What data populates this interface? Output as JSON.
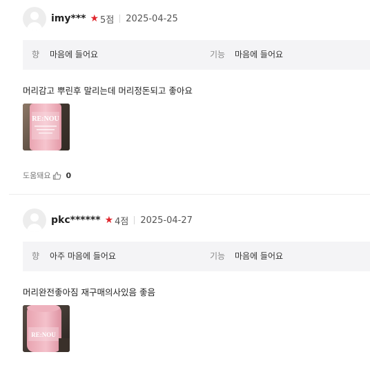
{
  "reviews": [
    {
      "username": "imy***",
      "rating": "5점",
      "date": "2025-04-25",
      "attributes": [
        {
          "label": "향",
          "value": "마음에 들어요"
        },
        {
          "label": "기능",
          "value": "마음에 들어요"
        }
      ],
      "text": "머리감고 뿌린후 말리는데 머리정돈되고 좋아요",
      "photo_brand": "RE:NOU",
      "helpful_label": "도움돼요",
      "helpful_count": "0"
    },
    {
      "username": "pkc******",
      "rating": "4점",
      "date": "2025-04-27",
      "attributes": [
        {
          "label": "향",
          "value": "아주 마음에 들어요"
        },
        {
          "label": "기능",
          "value": "마음에 들어요"
        }
      ],
      "text": "머리완전좋아짐 재구매의사있음 좋음",
      "photo_brand": "RE:NOU"
    }
  ],
  "colors": {
    "star": "#e0262d",
    "attribute_bg": "#f4f4f6",
    "bottle_pink": "#f2b8c2"
  },
  "icons": {
    "avatar": "user-silhouette-icon",
    "star": "star-icon",
    "helpful": "thumbs-up-icon"
  }
}
